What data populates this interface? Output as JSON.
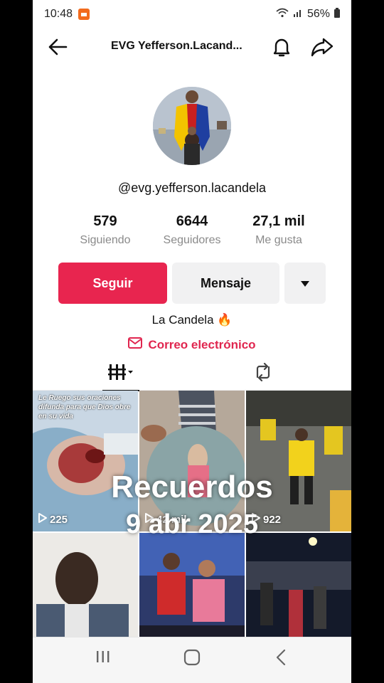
{
  "status_bar": {
    "time": "10:48",
    "battery": "56%"
  },
  "header": {
    "title": "EVG Yefferson.Lacand..."
  },
  "profile": {
    "handle": "@evg.yefferson.lacandela",
    "stats": [
      {
        "value": "579",
        "label": "Siguiendo"
      },
      {
        "value": "6644",
        "label": "Seguidores"
      },
      {
        "value": "27,1 mil",
        "label": "Me gusta"
      }
    ],
    "follow_label": "Seguir",
    "message_label": "Mensaje",
    "bio": "La Candela 🔥",
    "email_label": "Correo electrónico"
  },
  "videos": [
    {
      "views": "225",
      "caption": "Le Ruego sus oraciones difunda para que Dios obre en su vida"
    },
    {
      "views": "42 mil"
    },
    {
      "views": "922"
    },
    {
      "views": ""
    },
    {
      "views": ""
    },
    {
      "views": ""
    }
  ],
  "memories": {
    "title": "Recuerdos",
    "date": "9 abr 2025"
  },
  "colors": {
    "accent": "#e8254f",
    "email": "#e0264f"
  }
}
